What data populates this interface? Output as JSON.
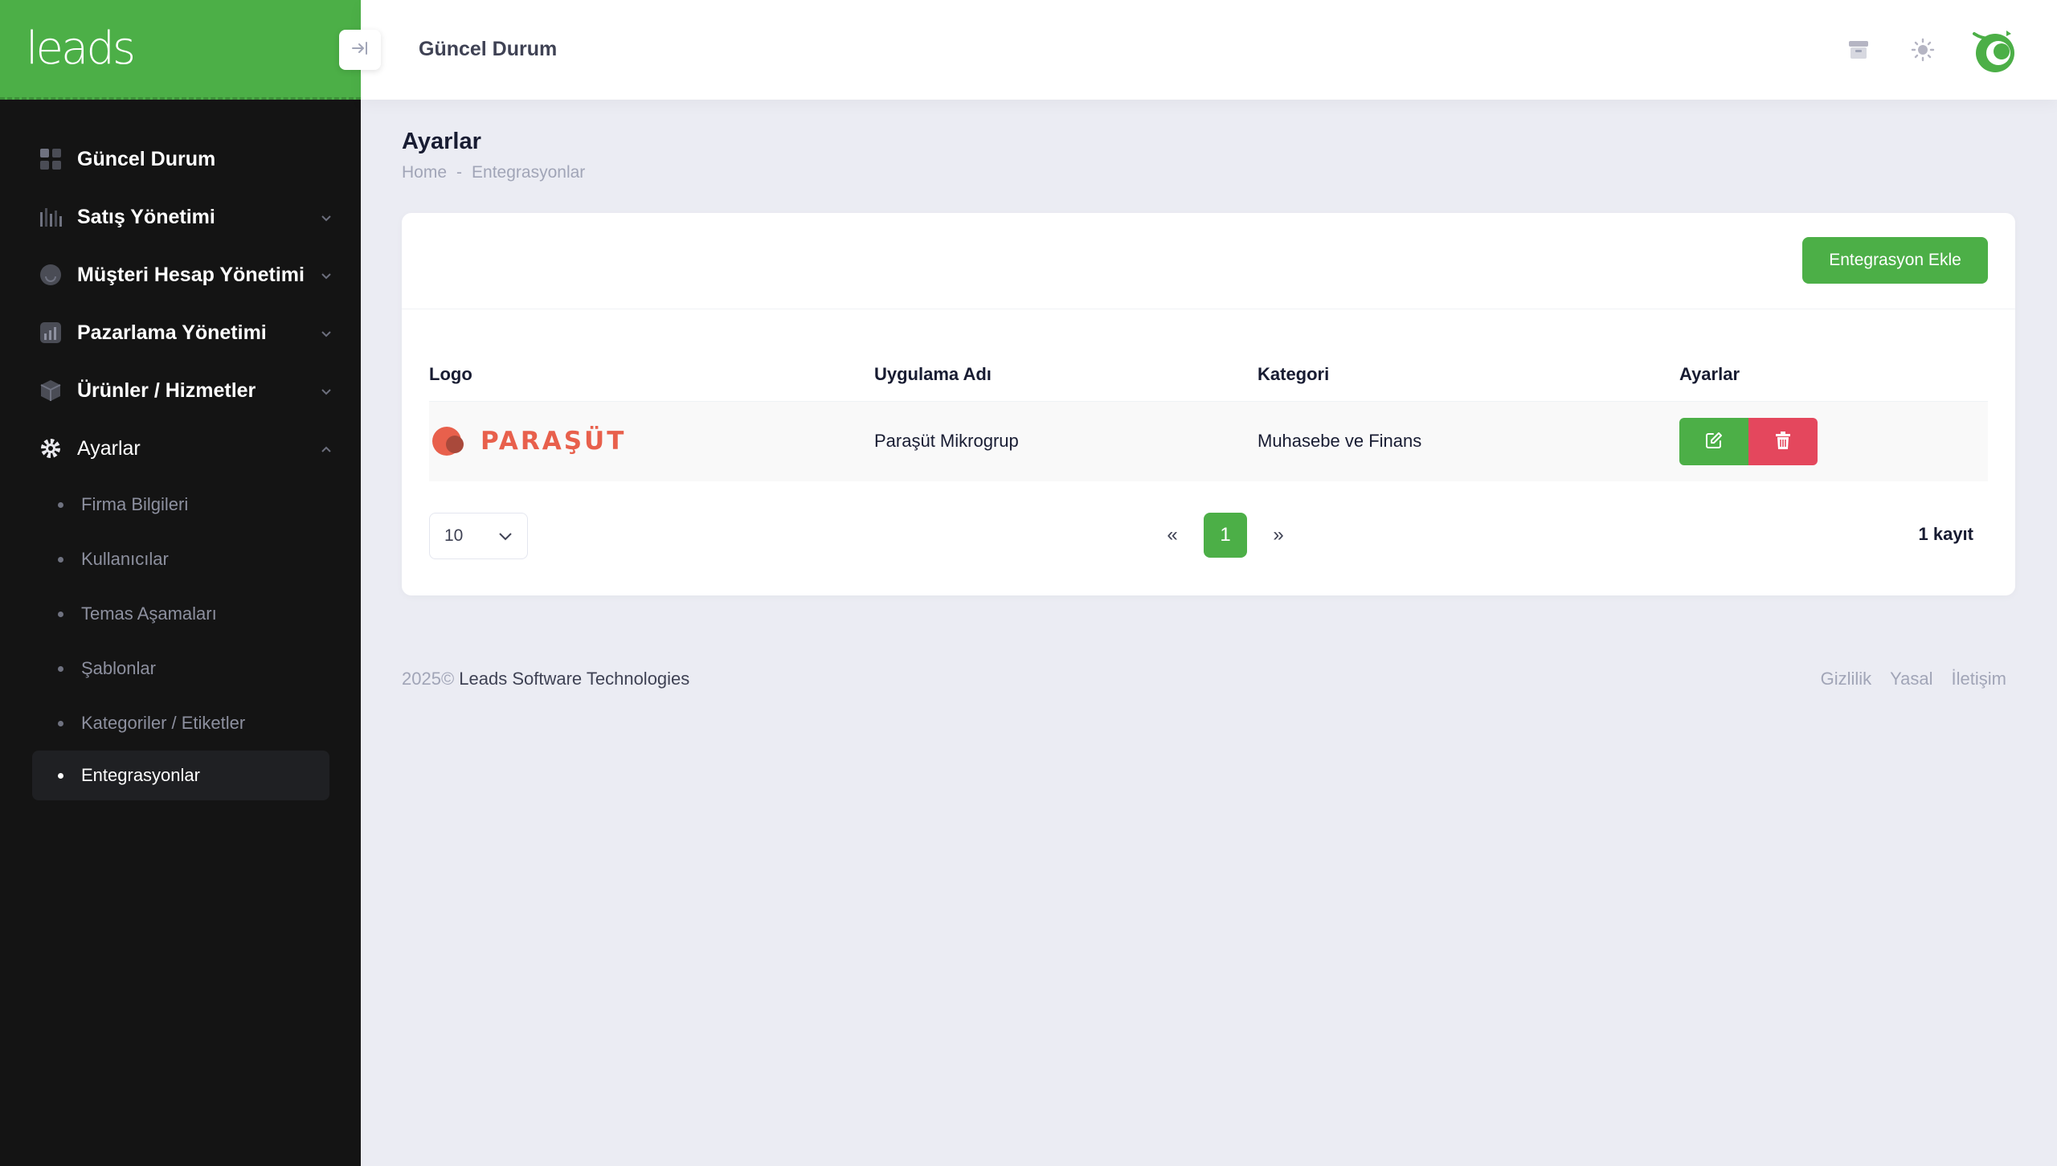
{
  "brand": {
    "logo_text": "leads"
  },
  "sidebar": {
    "items": [
      {
        "label": "Güncel Durum",
        "icon": "dashboard-grid-icon",
        "expandable": false
      },
      {
        "label": "Satış Yönetimi",
        "icon": "sales-chart-icon",
        "expandable": true
      },
      {
        "label": "Müşteri Hesap Yönetimi",
        "icon": "customer-icon",
        "expandable": true
      },
      {
        "label": "Pazarlama Yönetimi",
        "icon": "marketing-chart-icon",
        "expandable": true
      },
      {
        "label": "Ürünler / Hizmetler",
        "icon": "box-icon",
        "expandable": true
      },
      {
        "label": "Ayarlar",
        "icon": "gear-icon",
        "expandable": true,
        "expanded": true
      }
    ],
    "subitems": [
      {
        "label": "Firma Bilgileri"
      },
      {
        "label": "Kullanıcılar"
      },
      {
        "label": "Temas Aşamaları"
      },
      {
        "label": "Şablonlar"
      },
      {
        "label": "Kategoriler / Etiketler"
      },
      {
        "label": "Entegrasyonlar",
        "active": true
      }
    ]
  },
  "header": {
    "title": "Güncel Durum"
  },
  "page": {
    "title": "Ayarlar",
    "breadcrumb": {
      "home": "Home",
      "sep": "-",
      "current": "Entegrasyonlar"
    }
  },
  "card": {
    "add_button": "Entegrasyon Ekle",
    "columns": [
      "Logo",
      "Uygulama Adı",
      "Kategori",
      "Ayarlar"
    ],
    "rows": [
      {
        "logo_text": "PARAŞÜT",
        "app_name": "Paraşüt Mikrogrup",
        "category": "Muhasebe ve Finans"
      }
    ],
    "page_size": "10",
    "pagination": {
      "prev": "«",
      "current": "1",
      "next": "»"
    },
    "record_count": "1 kayıt"
  },
  "footer": {
    "year": "2025©",
    "company": "Leads Software Technologies",
    "links": [
      "Gizlilik",
      "Yasal",
      "İletişim"
    ]
  },
  "colors": {
    "primary": "#4caf47",
    "danger": "#e4475d",
    "sidebar_bg": "#141414",
    "page_bg": "#ebecf3"
  }
}
